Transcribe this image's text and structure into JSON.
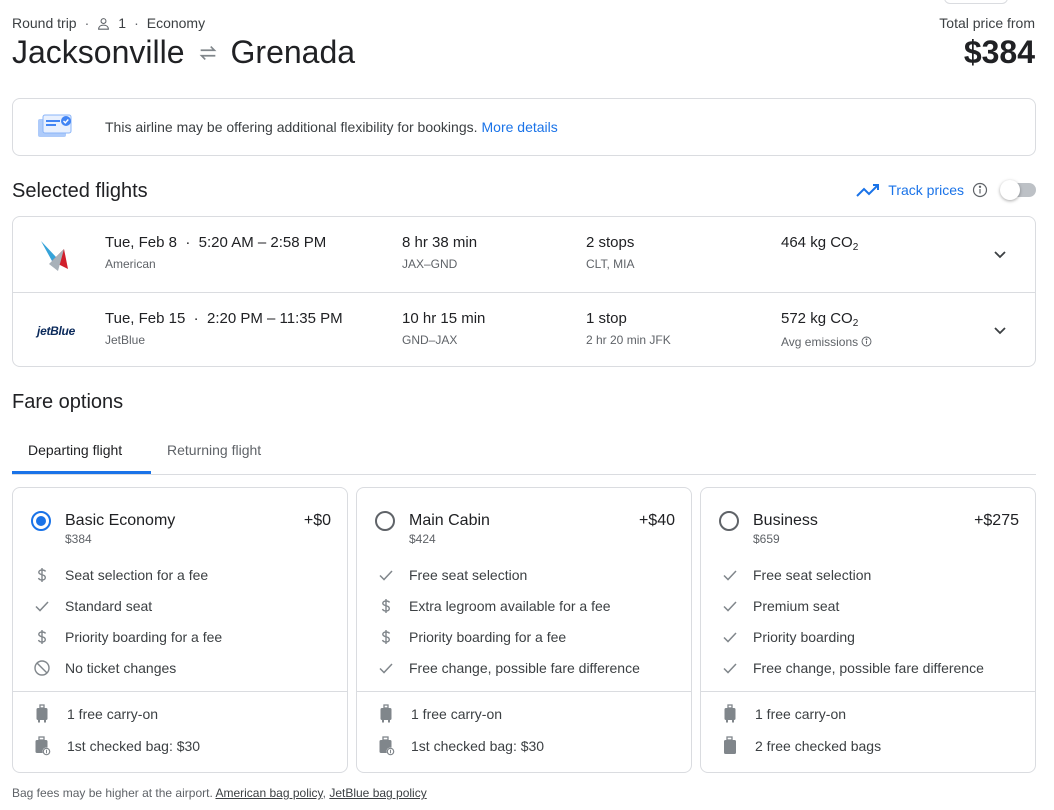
{
  "header": {
    "trip_type": "Round trip",
    "sep": "·",
    "passengers": "1",
    "cabin": "Economy",
    "origin": "Jacksonville",
    "destination": "Grenada",
    "total_label": "Total price from",
    "total_price": "$384"
  },
  "banner": {
    "text": "This airline may be offering additional flexibility for bookings.",
    "link": "More details"
  },
  "selected": {
    "title": "Selected flights",
    "track_label": "Track prices"
  },
  "flights": [
    {
      "date": "Tue, Feb 8",
      "times": "5:20 AM – 2:58 PM",
      "airline": "American",
      "duration": "8 hr 38 min",
      "route": "JAX–GND",
      "stops": "2 stops",
      "stop_detail": "CLT, MIA",
      "co2": "464 kg CO",
      "co2_sub": "2",
      "co2_note": ""
    },
    {
      "date": "Tue, Feb 15",
      "times": "2:20 PM – 11:35 PM",
      "airline": "JetBlue",
      "logo_text": "jetBlue",
      "duration": "10 hr 15 min",
      "route": "GND–JAX",
      "stops": "1 stop",
      "stop_detail": "2 hr 20 min JFK",
      "co2": "572 kg CO",
      "co2_sub": "2",
      "co2_note": "Avg emissions"
    }
  ],
  "fare": {
    "title": "Fare options",
    "tabs": [
      "Departing flight",
      "Returning flight"
    ],
    "cards": [
      {
        "name": "Basic Economy",
        "base": "$384",
        "delta": "+$0",
        "features": [
          {
            "icon": "dollar-icon",
            "text": "Seat selection for a fee"
          },
          {
            "icon": "check-icon",
            "text": "Standard seat"
          },
          {
            "icon": "dollar-icon",
            "text": "Priority boarding for a fee"
          },
          {
            "icon": "no-icon",
            "text": "No ticket changes"
          }
        ],
        "bags": [
          {
            "icon": "carry-on-icon",
            "text": "1 free carry-on"
          },
          {
            "icon": "checked-bag-fee-icon",
            "text": "1st checked bag: $30"
          }
        ]
      },
      {
        "name": "Main Cabin",
        "base": "$424",
        "delta": "+$40",
        "features": [
          {
            "icon": "check-icon",
            "text": "Free seat selection"
          },
          {
            "icon": "dollar-icon",
            "text": "Extra legroom available for a fee"
          },
          {
            "icon": "dollar-icon",
            "text": "Priority boarding for a fee"
          },
          {
            "icon": "check-icon",
            "text": "Free change, possible fare difference"
          }
        ],
        "bags": [
          {
            "icon": "carry-on-icon",
            "text": "1 free carry-on"
          },
          {
            "icon": "checked-bag-fee-icon",
            "text": "1st checked bag: $30"
          }
        ]
      },
      {
        "name": "Business",
        "base": "$659",
        "delta": "+$275",
        "features": [
          {
            "icon": "check-icon",
            "text": "Free seat selection"
          },
          {
            "icon": "check-icon",
            "text": "Premium seat"
          },
          {
            "icon": "check-icon",
            "text": "Priority boarding"
          },
          {
            "icon": "check-icon",
            "text": "Free change, possible fare difference"
          }
        ],
        "bags": [
          {
            "icon": "carry-on-icon",
            "text": "1 free carry-on"
          },
          {
            "icon": "checked-bag-icon",
            "text": "2 free checked bags"
          }
        ]
      }
    ]
  },
  "footer": {
    "note": "Bag fees may be higher at the airport.",
    "link1": "American bag policy",
    "comma": ",",
    "link2": "JetBlue bag policy"
  },
  "colors": {
    "accent": "#1a73e8",
    "text": "#202124",
    "muted": "#5f6368",
    "border": "#dadce0"
  }
}
